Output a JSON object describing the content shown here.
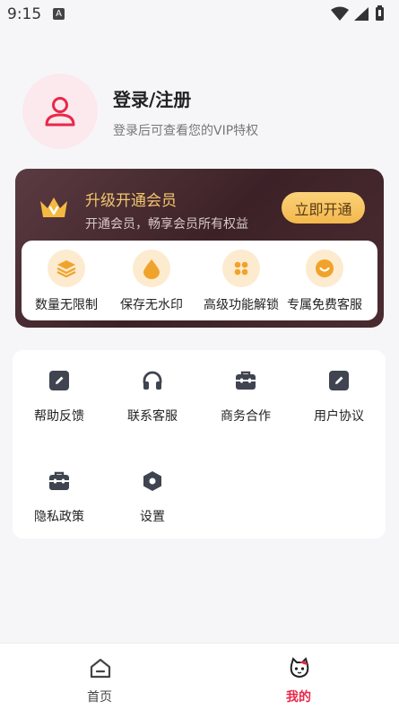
{
  "status_bar": {
    "time": "9:15",
    "notification_badge": "A",
    "icons": [
      "wifi-icon",
      "signal-icon",
      "battery-icon"
    ]
  },
  "profile": {
    "title": "登录/注册",
    "subtitle": "登录后可查看您的VIP特权",
    "avatar_icon": "user-icon"
  },
  "vip": {
    "title": "升级开通会员",
    "subtitle": "开通会员，畅享会员所有权益",
    "button_label": "立即开通",
    "perks": [
      {
        "label": "数量无限制",
        "icon": "layers-icon"
      },
      {
        "label": "保存无水印",
        "icon": "drop-icon"
      },
      {
        "label": "高级功能解锁",
        "icon": "grid-icon"
      },
      {
        "label": "专属免费客服",
        "icon": "smile-icon"
      }
    ]
  },
  "menu": {
    "items": [
      {
        "label": "帮助反馈",
        "icon": "edit-icon"
      },
      {
        "label": "联系客服",
        "icon": "headphones-icon"
      },
      {
        "label": "商务合作",
        "icon": "briefcase-icon"
      },
      {
        "label": "用户协议",
        "icon": "edit-icon"
      },
      {
        "label": "隐私政策",
        "icon": "briefcase-icon"
      },
      {
        "label": "设置",
        "icon": "hexagon-settings-icon"
      }
    ]
  },
  "bottom_nav": {
    "items": [
      {
        "label": "首页",
        "icon": "home-icon",
        "active": false
      },
      {
        "label": "我的",
        "icon": "cat-avatar-icon",
        "active": true
      }
    ],
    "active_color": "#e8284a",
    "inactive_color": "#444444"
  },
  "colors": {
    "accent_red": "#e8284a",
    "vip_gold": "#f3c56d",
    "vip_button": "#f6c15a",
    "vip_card_bg": "#46282e"
  }
}
